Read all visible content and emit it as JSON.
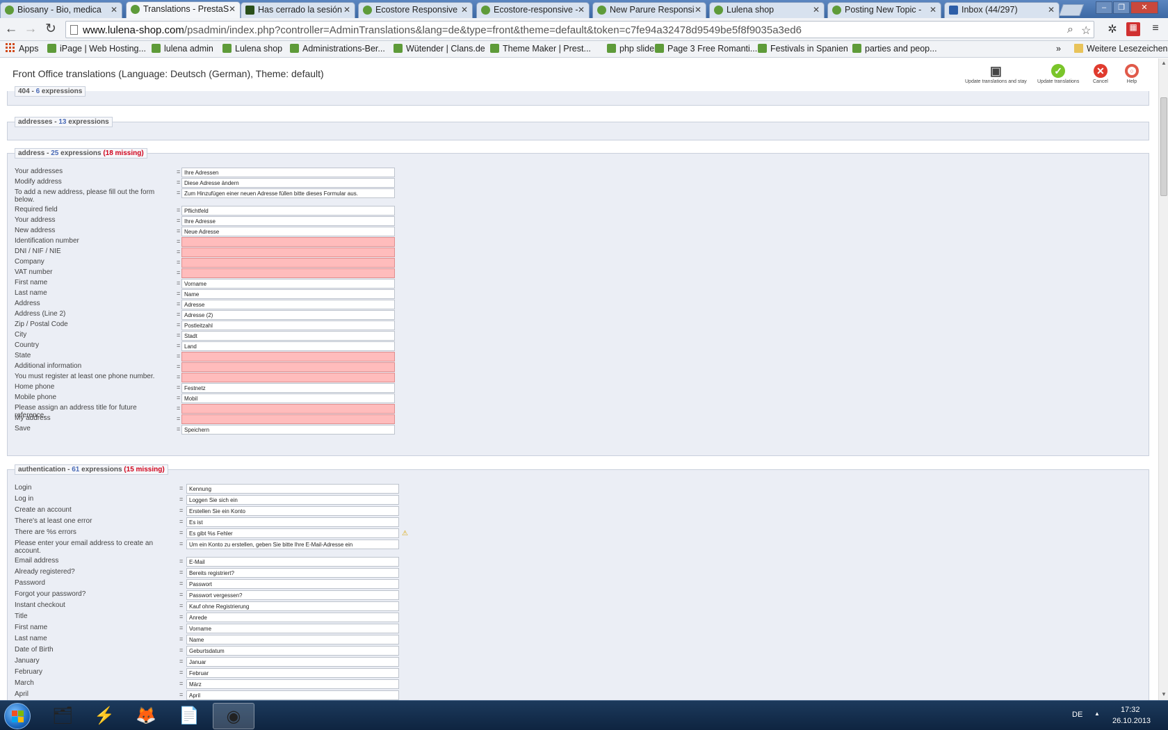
{
  "browser": {
    "tabs": [
      {
        "title": "Biosany - Bio, medica",
        "icon": "leaf"
      },
      {
        "title": "Translations - PrestaS",
        "icon": "leaf",
        "active": true
      },
      {
        "title": "Has cerrado la sesión",
        "icon": "dark"
      },
      {
        "title": "Ecostore Responsive",
        "icon": "leaf"
      },
      {
        "title": "Ecostore-responsive -",
        "icon": "leaf"
      },
      {
        "title": "New Parure Responsi",
        "icon": "leaf"
      },
      {
        "title": "Lulena shop",
        "icon": "leaf"
      },
      {
        "title": "Posting New Topic - ",
        "icon": "leaf"
      },
      {
        "title": "Inbox (44/297)",
        "icon": "mail"
      }
    ],
    "url_host": "www.lulena-shop.com",
    "url_rest": "/psadmin/index.php?controller=AdminTranslations&lang=de&type=front&theme=default&token=c7fe94a32478d9549be5f8f9035a3ed6",
    "bookmarks": [
      "Apps",
      "iPage | Web Hosting...",
      "lulena admin",
      "Lulena shop",
      "Administrations-Ber...",
      "Wütender | Clans.de",
      "Theme Maker | Prest...",
      "php slider",
      "Page 3 Free Romanti...",
      "Festivals in Spanien",
      "parties and peop..."
    ],
    "bookmarks_more": "»",
    "other_bookmarks": "Weitere Lesezeichen"
  },
  "header": {
    "title": "Front Office translations (Language: Deutsch (German), Theme: default)",
    "btn_update_stay": "Update translations and stay",
    "btn_update": "Update translations",
    "btn_cancel": "Cancel",
    "btn_help": "Help"
  },
  "sections": {
    "s404": {
      "name": "404",
      "sep": " - ",
      "count": "6",
      "suffix": " expressions"
    },
    "addresses": {
      "name": "addresses",
      "sep": " - ",
      "count": "13",
      "suffix": " expressions"
    },
    "address": {
      "name": "address",
      "sep": " - ",
      "count": "25",
      "suffix": " expressions",
      "missing": "(18 missing)",
      "rows": [
        {
          "label": "Your addresses",
          "value": "Ihre Adressen"
        },
        {
          "label": "Modify address",
          "value": "Diese Adresse ändern"
        },
        {
          "label": "To add a new address, please fill out the form below.",
          "value": "Zum Hinzufügen einer neuen Adresse füllen bitte dieses Formular aus."
        },
        {
          "label": "Required field",
          "value": "Pflichtfeld"
        },
        {
          "label": "Your address",
          "value": "Ihre Adresse"
        },
        {
          "label": "New address",
          "value": "Neue Adresse"
        },
        {
          "label": "Identification number",
          "value": ""
        },
        {
          "label": "DNI / NIF / NIE",
          "value": ""
        },
        {
          "label": "Company",
          "value": ""
        },
        {
          "label": "VAT number",
          "value": ""
        },
        {
          "label": "First name",
          "value": "Vorname"
        },
        {
          "label": "Last name",
          "value": "Name"
        },
        {
          "label": "Address",
          "value": "Adresse"
        },
        {
          "label": "Address (Line 2)",
          "value": "Adresse (2)"
        },
        {
          "label": "Zip / Postal Code",
          "value": "Postleitzahl"
        },
        {
          "label": "City",
          "value": "Stadt"
        },
        {
          "label": "Country",
          "value": "Land"
        },
        {
          "label": "State",
          "value": ""
        },
        {
          "label": "Additional information",
          "value": ""
        },
        {
          "label": "You must register at least one phone number.",
          "value": ""
        },
        {
          "label": "Home phone",
          "value": "Festnetz"
        },
        {
          "label": "Mobile phone",
          "value": "Mobil"
        },
        {
          "label": "Please assign an address title for future reference.",
          "value": ""
        },
        {
          "label": "My address",
          "value": ""
        },
        {
          "label": "Save",
          "value": "Speichern"
        }
      ]
    },
    "authentication": {
      "name": "authentication",
      "sep": " - ",
      "count": "61",
      "suffix": " expressions",
      "missing": "(15 missing)",
      "rows": [
        {
          "label": "Login",
          "value": "Kennung"
        },
        {
          "label": "Log in",
          "value": "Loggen Sie sich ein"
        },
        {
          "label": "Create an account",
          "value": "Erstellen Sie ein Konto"
        },
        {
          "label": "There's at least one error",
          "value": "Es ist"
        },
        {
          "label": "There are %s errors",
          "value": "Es gibt %s Fehler",
          "warn": true
        },
        {
          "label": "Please enter your email address to create an account.",
          "value": "Um ein Konto zu erstellen, geben Sie bitte Ihre E-Mail-Adresse ein"
        },
        {
          "label": "Email address",
          "value": "E-Mail"
        },
        {
          "label": "Already registered?",
          "value": "Bereits registriert?"
        },
        {
          "label": "Password",
          "value": "Passwort"
        },
        {
          "label": "Forgot your password?",
          "value": "Passwort vergessen?"
        },
        {
          "label": "Instant checkout",
          "value": "Kauf ohne Registrierung"
        },
        {
          "label": "Title",
          "value": "Anrede"
        },
        {
          "label": "First name",
          "value": "Vorname"
        },
        {
          "label": "Last name",
          "value": "Name"
        },
        {
          "label": "Date of Birth",
          "value": "Geburtsdatum"
        },
        {
          "label": "January",
          "value": "Januar"
        },
        {
          "label": "February",
          "value": "Februar"
        },
        {
          "label": "March",
          "value": "März"
        },
        {
          "label": "April",
          "value": "April"
        }
      ]
    }
  },
  "separator": "=",
  "taskbar": {
    "lang": "DE",
    "time": "17:32",
    "date": "26.10.2013"
  }
}
